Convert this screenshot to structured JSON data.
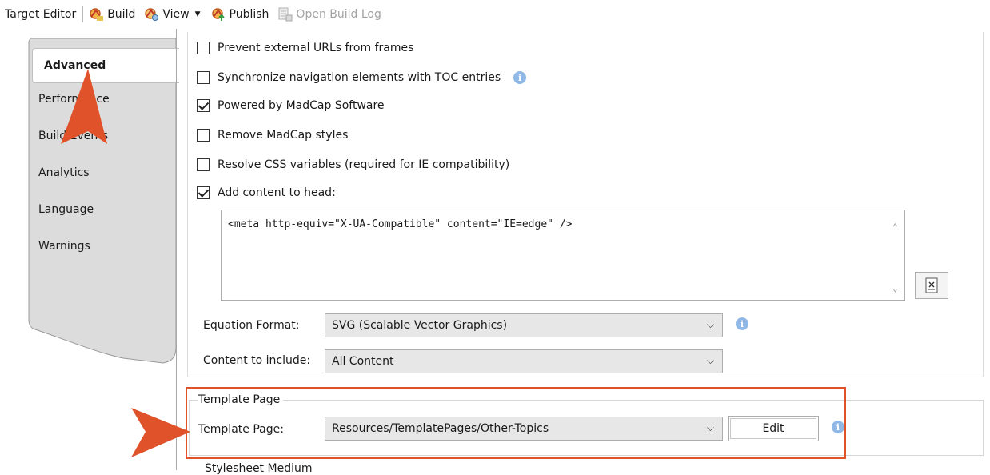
{
  "toolbar": {
    "title": "Target Editor",
    "build_label": "Build",
    "view_label": "View",
    "publish_label": "Publish",
    "open_build_log_label": "Open Build Log"
  },
  "tabs": [
    {
      "label": "Advanced",
      "active": true
    },
    {
      "label": "Performance"
    },
    {
      "label": "Build Events"
    },
    {
      "label": "Analytics"
    },
    {
      "label": "Language"
    },
    {
      "label": "Warnings"
    }
  ],
  "options": {
    "prevent_external_urls": {
      "label": "Prevent external URLs from frames",
      "checked": false
    },
    "sync_navigation": {
      "label": "Synchronize navigation elements with TOC entries",
      "checked": false
    },
    "powered_by": {
      "label": "Powered by MadCap Software",
      "checked": true
    },
    "remove_styles": {
      "label": "Remove MadCap styles",
      "checked": false
    },
    "resolve_css": {
      "label": "Resolve CSS variables (required for IE compatibility)",
      "checked": false
    },
    "add_head": {
      "label": "Add content to head:",
      "checked": true
    }
  },
  "head_content": "<meta http-equiv=\"X-UA-Compatible\" content=\"IE=edge\" />",
  "equation_format": {
    "label": "Equation Format:",
    "value": "SVG (Scalable Vector Graphics)"
  },
  "content_to_include": {
    "label": "Content to include:",
    "value": "All Content"
  },
  "template_page": {
    "group_title": "Template Page",
    "label": "Template Page:",
    "value": "Resources/TemplatePages/Other-Topics",
    "edit_label": "Edit"
  },
  "stylesheet_medium_label": "Stylesheet Medium",
  "colors": {
    "annotation": "#e0522a",
    "info": "#8fb8e6"
  },
  "icons": {
    "info": "i",
    "chevron": "⌵"
  }
}
